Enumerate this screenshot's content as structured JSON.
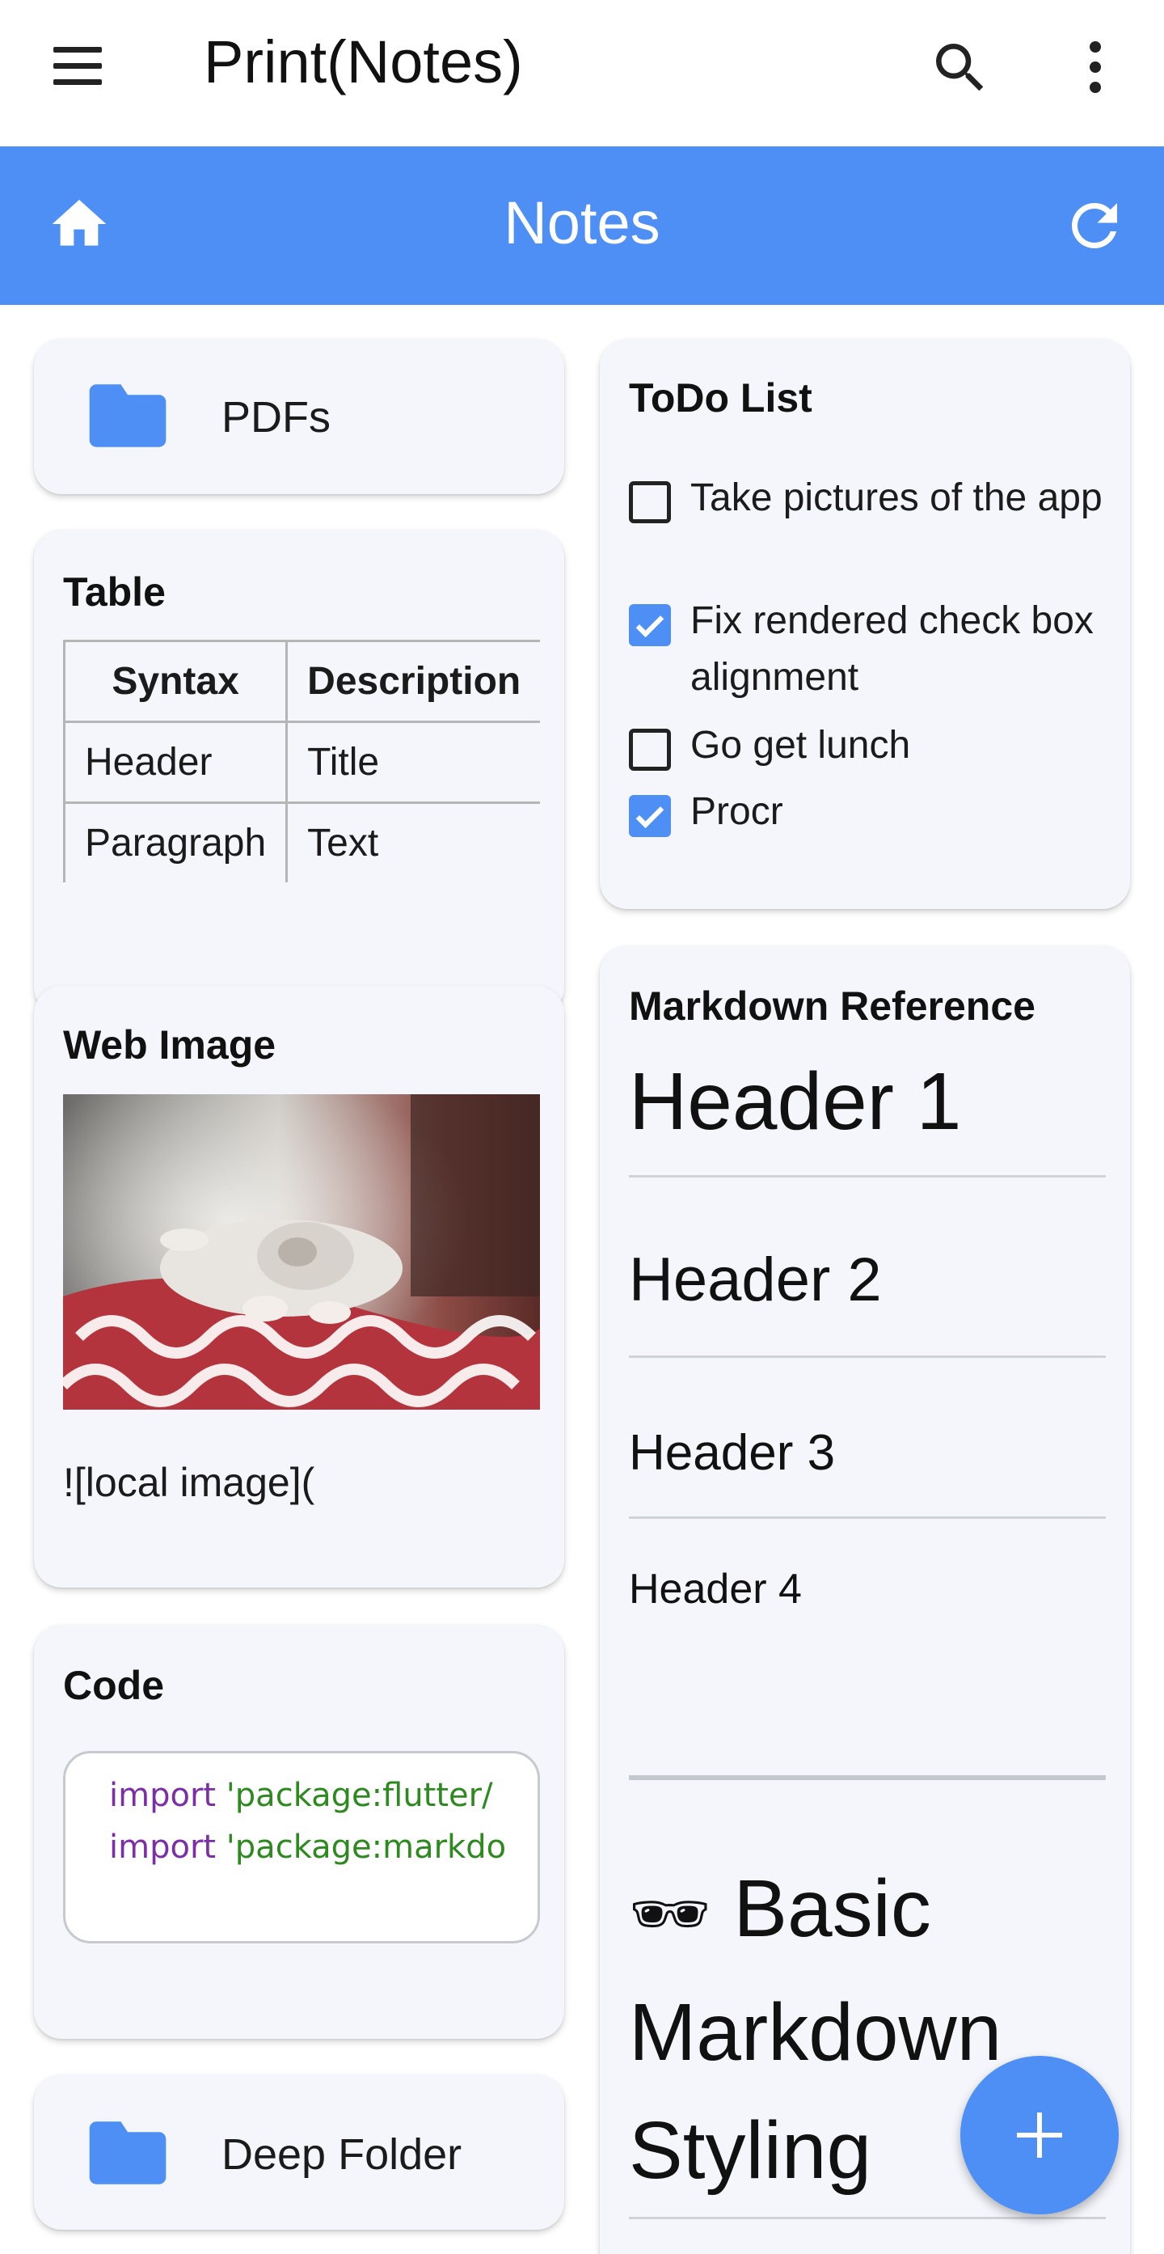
{
  "appbar": {
    "title": "Print(Notes)"
  },
  "header": {
    "title": "Notes"
  },
  "cards": {
    "pdfs": {
      "label": "PDFs"
    },
    "table": {
      "title": "Table",
      "headers": [
        "Syntax",
        "Description"
      ],
      "rows": [
        [
          "Header",
          "Title"
        ],
        [
          "Paragraph",
          "Text"
        ]
      ]
    },
    "web_image": {
      "title": "Web Image",
      "caption": "![local image]("
    },
    "code": {
      "title": "Code",
      "lines": [
        {
          "keyword": "import",
          "string": "'package:flutter/"
        },
        {
          "keyword": "import",
          "string": "'package:markdo"
        }
      ]
    },
    "deep_folder": {
      "label": "Deep Folder"
    },
    "todo": {
      "title": "ToDo List",
      "items": [
        {
          "text": "Take pictures of the app",
          "checked": false
        },
        {
          "text": "Fix rendered check box alignment",
          "checked": true
        },
        {
          "text": "Go get lunch",
          "checked": false
        },
        {
          "text": "Procr",
          "checked": true
        }
      ]
    },
    "markdown_ref": {
      "title": "Markdown Reference",
      "h1": "Header 1",
      "h2": "Header 2",
      "h3": "Header 3",
      "h4": "Header 4",
      "basic_emoji": "🕶",
      "basic_line1": "Basic",
      "basic_line2": "Markdown",
      "basic_line3": "Styling"
    }
  },
  "colors": {
    "accent": "#4e8ff5",
    "card_bg": "#f4f6fb",
    "keyword": "#7b2ea8",
    "string": "#2c8a1f"
  },
  "icons": {
    "menu": "menu-icon",
    "search": "search-icon",
    "more": "more-vert-icon",
    "home": "home-icon",
    "refresh": "refresh-icon",
    "folder": "folder-icon",
    "check": "check-icon",
    "add": "add-icon"
  }
}
